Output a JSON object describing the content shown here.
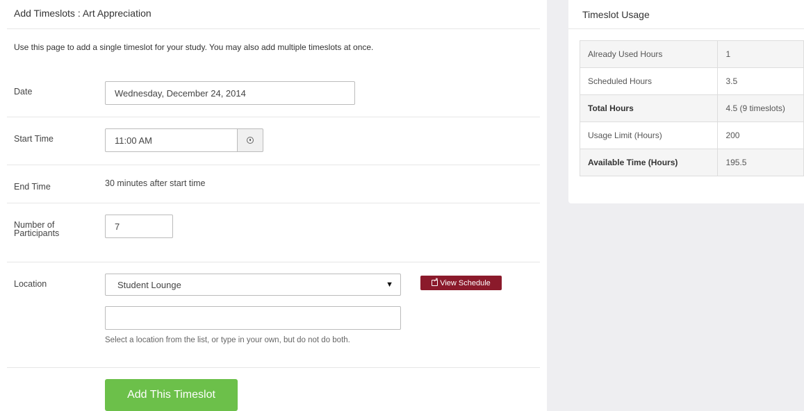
{
  "page": {
    "title": "Add Timeslots : Art Appreciation",
    "intro": "Use this page to add a single timeslot for your study. You may also add multiple timeslots at once."
  },
  "form": {
    "date_label": "Date",
    "date_value": "Wednesday, December 24, 2014",
    "start_time_label": "Start Time",
    "start_time_value": "11:00 AM",
    "end_time_label": "End Time",
    "end_time_value": "30 minutes after start time",
    "participants_label_line1": "Number of",
    "participants_label_line2": "Participants",
    "participants_value": "7",
    "location_label": "Location",
    "location_selected": "Student Lounge",
    "location_custom_value": "",
    "location_help": "Select a location from the list, or type in your own, but do not do both.",
    "view_schedule_label": "View Schedule",
    "submit_label": "Add This Timeslot"
  },
  "usage": {
    "title": "Timeslot Usage",
    "rows": [
      {
        "label": "Already Used Hours",
        "value": "1"
      },
      {
        "label": "Scheduled Hours",
        "value": "3.5"
      },
      {
        "label": "Total Hours",
        "value": "4.5 (9 timeslots)"
      },
      {
        "label": "Usage Limit (Hours)",
        "value": "200"
      },
      {
        "label": "Available Time (Hours)",
        "value": "195.5"
      }
    ]
  },
  "colors": {
    "view_schedule_bg": "#8b1a2b",
    "submit_bg": "#6cc04a",
    "side_bg": "#eeeef1"
  },
  "icons": {
    "start_time_addon": "clock-icon",
    "view_schedule": "external-link-icon",
    "select_caret": "caret-down-icon"
  }
}
